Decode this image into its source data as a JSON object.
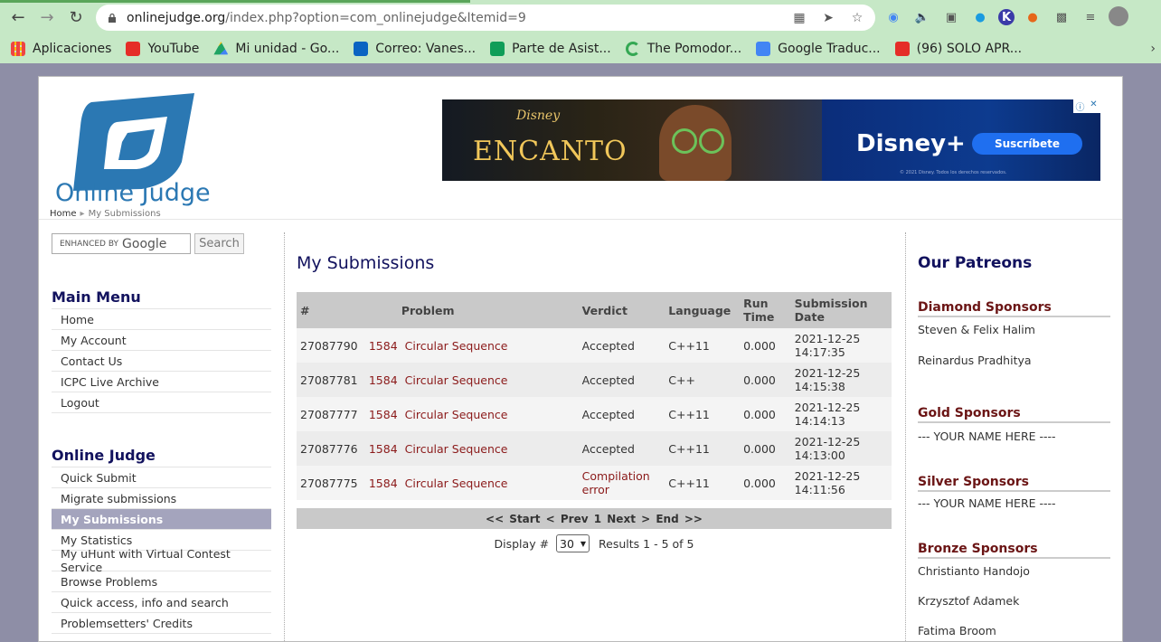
{
  "browser": {
    "url_host": "onlinejudge.org",
    "url_rest": "/index.php?option=com_onlinejudge&Itemid=9",
    "bookmarks": [
      {
        "label": "Aplicaciones",
        "color": "#e44"
      },
      {
        "label": "YouTube",
        "color": "#e52d27"
      },
      {
        "label": "Mi unidad - Go...",
        "color": "#1fa463"
      },
      {
        "label": "Correo: Vanes...",
        "color": "#0a64c2"
      },
      {
        "label": "Parte de Asist...",
        "color": "#0f9d58"
      },
      {
        "label": "The Pomodor...",
        "color": "#34a853"
      },
      {
        "label": "Google Traduc...",
        "color": "#4285f4"
      },
      {
        "label": "(96) SOLO APR...",
        "color": "#e52d27"
      }
    ]
  },
  "site": {
    "logo_text": "Online Judge",
    "breadcrumb": {
      "home": "Home",
      "current": "My Submissions"
    }
  },
  "ad": {
    "brand": "Disney",
    "movie": "ENCANTO",
    "service": "Disney+",
    "cta": "Suscríbete",
    "fine_print": "© 2021 Disney. Todos los derechos reservados."
  },
  "search": {
    "label": "ENHANCED BY",
    "brand": "Google",
    "button": "Search"
  },
  "main_menu": {
    "title": "Main Menu",
    "items": [
      "Home",
      "My Account",
      "Contact Us",
      "ICPC Live Archive",
      "Logout"
    ]
  },
  "oj_menu": {
    "title": "Online Judge",
    "items": [
      "Quick Submit",
      "Migrate submissions",
      "My Submissions",
      "My Statistics",
      "My uHunt with Virtual Contest Service",
      "Browse Problems",
      "Quick access, info and search",
      "Problemsetters' Credits"
    ],
    "active": "My Submissions"
  },
  "submissions": {
    "title": "My Submissions",
    "headers": {
      "id": "#",
      "problem": "Problem",
      "verdict": "Verdict",
      "language": "Language",
      "runtime_1": "Run",
      "runtime_2": "Time",
      "date": "Submission Date"
    },
    "rows": [
      {
        "id": "27087790",
        "pid": "1584",
        "pname": "Circular Sequence",
        "verdict": "Accepted",
        "lang": "C++11",
        "time": "0.000",
        "date": "2021-12-25",
        "clock": "14:17:35"
      },
      {
        "id": "27087781",
        "pid": "1584",
        "pname": "Circular Sequence",
        "verdict": "Accepted",
        "lang": "C++",
        "time": "0.000",
        "date": "2021-12-25",
        "clock": "14:15:38"
      },
      {
        "id": "27087777",
        "pid": "1584",
        "pname": "Circular Sequence",
        "verdict": "Accepted",
        "lang": "C++11",
        "time": "0.000",
        "date": "2021-12-25",
        "clock": "14:14:13"
      },
      {
        "id": "27087776",
        "pid": "1584",
        "pname": "Circular Sequence",
        "verdict": "Accepted",
        "lang": "C++11",
        "time": "0.000",
        "date": "2021-12-25",
        "clock": "14:13:00"
      },
      {
        "id": "27087775",
        "pid": "1584",
        "pname": "Circular Sequence",
        "verdict_1": "Compilation",
        "verdict_2": "error",
        "lang": "C++11",
        "time": "0.000",
        "date": "2021-12-25",
        "clock": "14:11:56"
      }
    ],
    "pager": {
      "start": "<< Start",
      "prev": "< Prev",
      "page": "1",
      "next": "Next >",
      "end": "End >>"
    },
    "display_label": "Display #",
    "display_value": "30",
    "results": "Results 1 - 5 of 5"
  },
  "patreons": {
    "title": "Our Patreons",
    "diamond": {
      "title": "Diamond Sponsors",
      "names": [
        "Steven & Felix Halim",
        "Reinardus Pradhitya"
      ]
    },
    "gold": {
      "title": "Gold Sponsors",
      "names": [
        "--- YOUR NAME HERE ----"
      ]
    },
    "silver": {
      "title": "Silver Sponsors",
      "names": [
        "--- YOUR NAME HERE ----"
      ]
    },
    "bronze": {
      "title": "Bronze Sponsors",
      "names": [
        "Christianto Handojo",
        "Krzysztof Adamek",
        "Fatima Broom"
      ]
    }
  }
}
